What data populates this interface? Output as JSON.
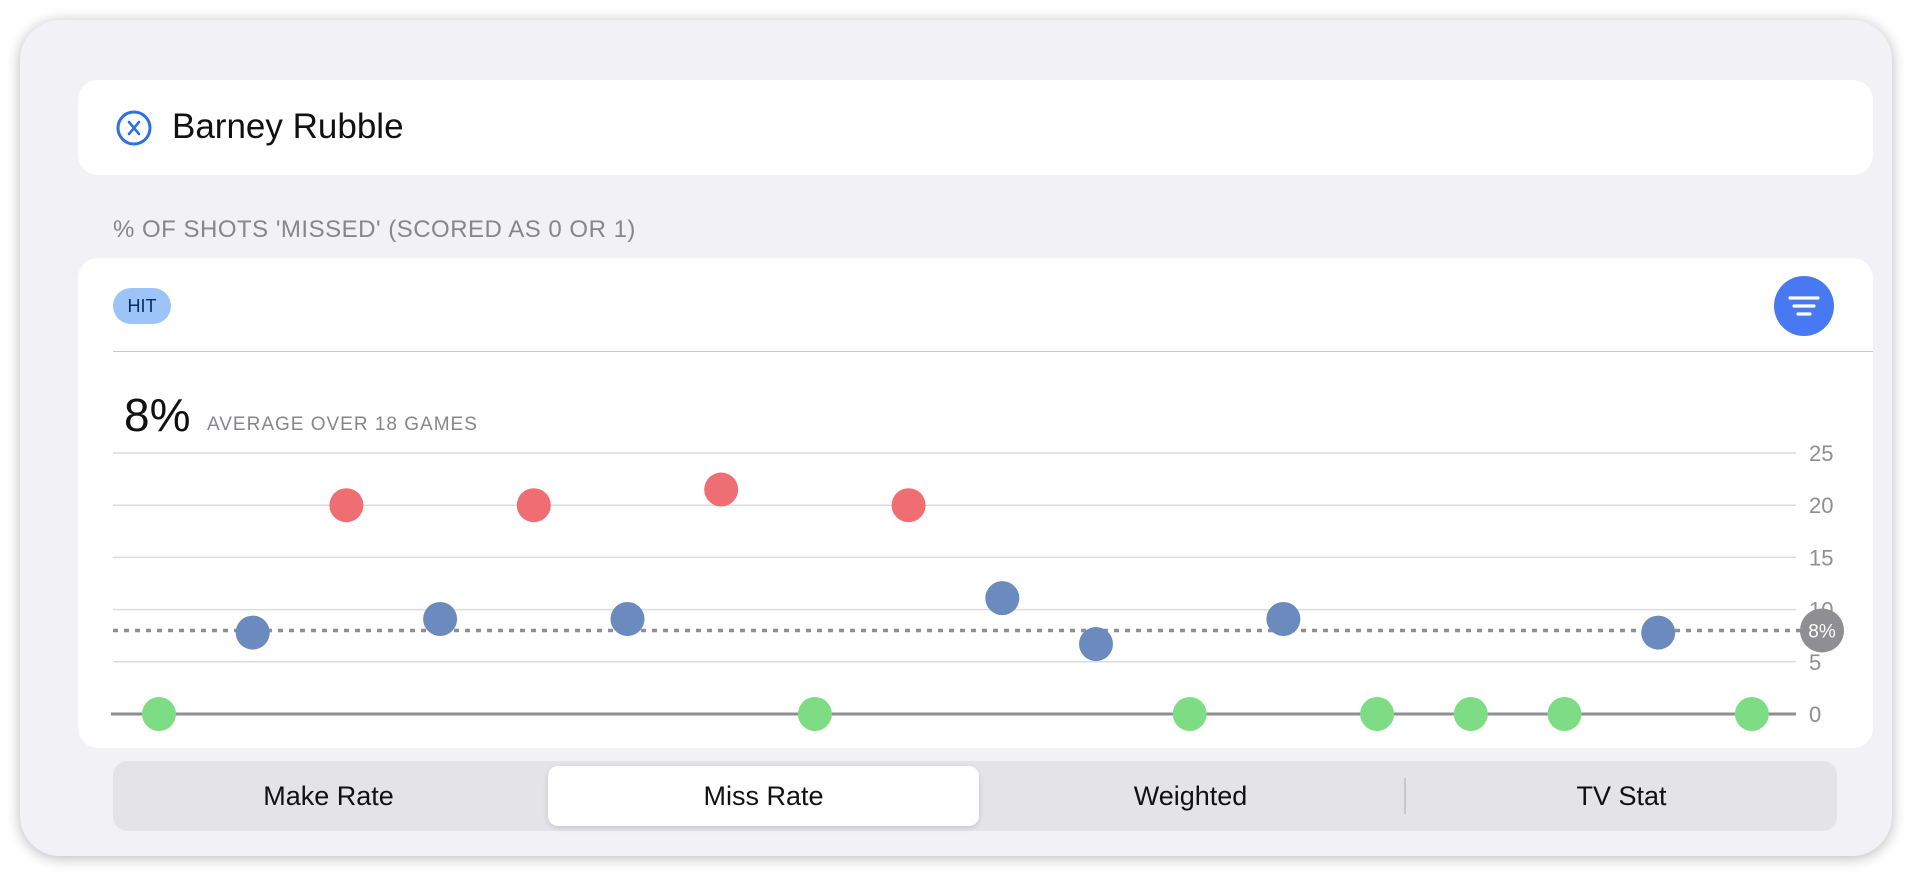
{
  "player": {
    "name": "Barney Rubble"
  },
  "section": {
    "title": "% OF SHOTS 'MISSED' (SCORED AS 0 OR 1)"
  },
  "card": {
    "badge": "HIT",
    "summary_value": "8%",
    "summary_label": "AVERAGE OVER 18 GAMES"
  },
  "chart_data": {
    "type": "scatter",
    "title": "",
    "xlabel": "",
    "ylabel": "",
    "ylim": [
      0,
      25
    ],
    "y_ticks": [
      25,
      20,
      15,
      10,
      5,
      0
    ],
    "grid": true,
    "average": {
      "value": 8,
      "label": "8%"
    },
    "x": [
      1,
      2,
      3,
      4,
      5,
      6,
      7,
      8,
      9,
      10,
      11,
      12,
      13,
      14,
      15,
      16,
      17,
      18
    ],
    "y": [
      0,
      7.8,
      20,
      9.1,
      20,
      9.1,
      21.5,
      0,
      20,
      11.1,
      6.7,
      0,
      9.1,
      0,
      0,
      0,
      7.8,
      0
    ],
    "point_colors": {
      "above": "#ee6e73",
      "middle": "#6b8abd",
      "zero": "#7edd84"
    }
  },
  "tabs": [
    {
      "label": "Make Rate",
      "selected": false
    },
    {
      "label": "Miss Rate",
      "selected": true
    },
    {
      "label": "Weighted",
      "selected": false
    },
    {
      "label": "TV Stat",
      "selected": false
    }
  ],
  "colors": {
    "accent": "#4879f2",
    "badge_bg": "#9cc4f8",
    "panel_bg": "#f1f1f6"
  }
}
